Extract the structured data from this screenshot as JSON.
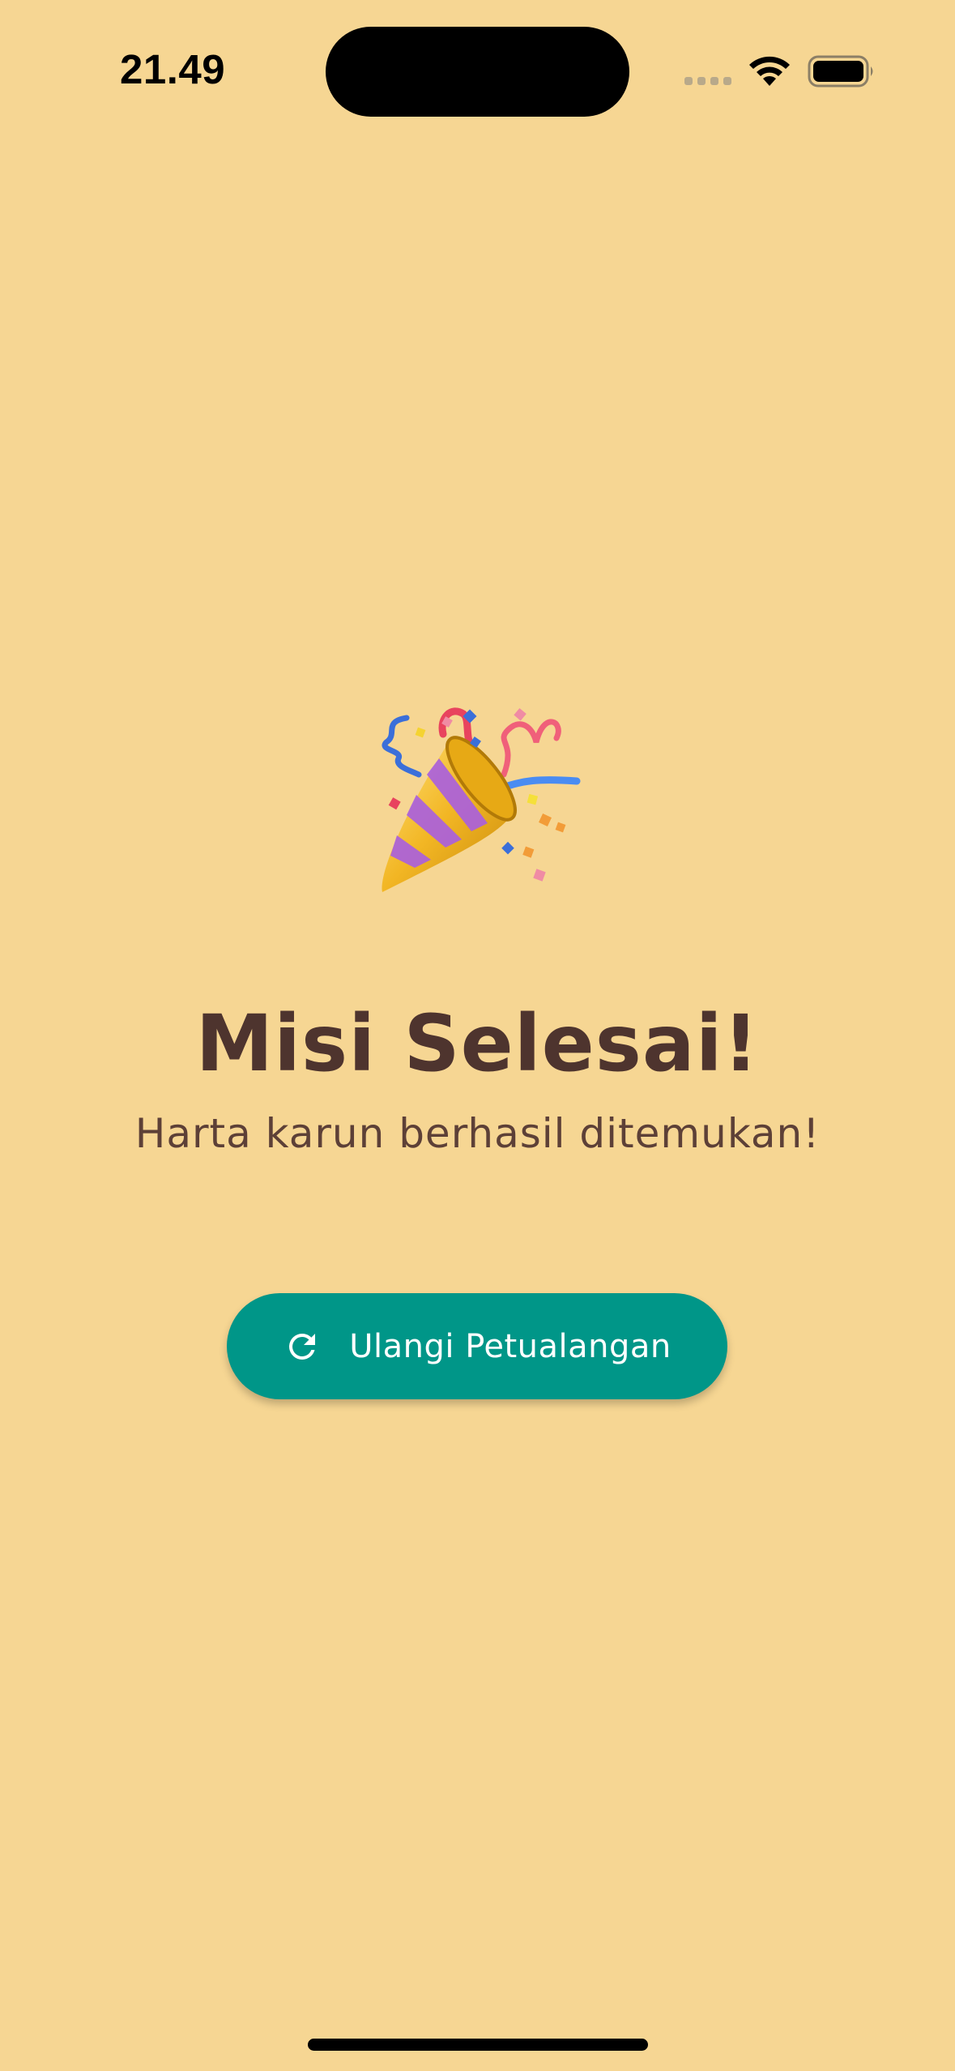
{
  "status_bar": {
    "time": "21.49",
    "icons": [
      "cellular-signal-icon",
      "wifi-icon",
      "battery-icon"
    ]
  },
  "main": {
    "emoji": "party-popper",
    "title": "Misi Selesai!",
    "subtitle": "Harta karun berhasil ditemukan!",
    "restart_button": {
      "icon": "refresh-icon",
      "label": "Ulangi Petualangan"
    }
  },
  "colors": {
    "background": "#F6D693",
    "title": "#4E342E",
    "subtitle": "#5D4037",
    "button": "#009688",
    "button_text": "#FFFFFF"
  }
}
